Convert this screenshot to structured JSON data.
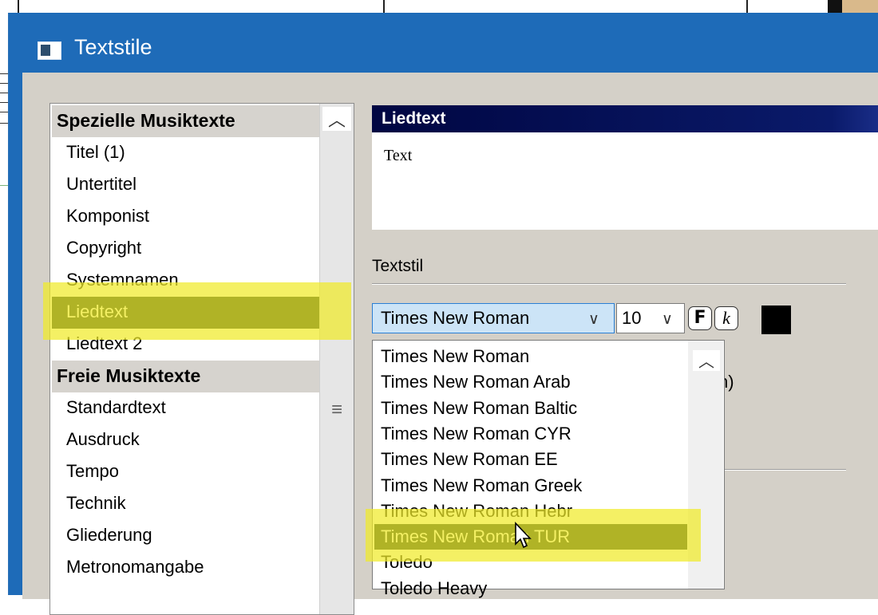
{
  "window": {
    "title": "Textstile"
  },
  "list": {
    "items": [
      {
        "label": "Spezielle Musiktexte",
        "kind": "header"
      },
      {
        "label": "Titel (1)",
        "kind": "item"
      },
      {
        "label": "Untertitel",
        "kind": "item"
      },
      {
        "label": "Komponist",
        "kind": "item"
      },
      {
        "label": "Copyright",
        "kind": "item"
      },
      {
        "label": "Systemnamen",
        "kind": "item"
      },
      {
        "label": "Liedtext",
        "kind": "item",
        "selected": true
      },
      {
        "label": "Liedtext 2",
        "kind": "item"
      },
      {
        "label": "Freie Musiktexte",
        "kind": "header"
      },
      {
        "label": "Standardtext",
        "kind": "item"
      },
      {
        "label": "Ausdruck",
        "kind": "item"
      },
      {
        "label": "Tempo",
        "kind": "item"
      },
      {
        "label": "Technik",
        "kind": "item"
      },
      {
        "label": "Gliederung",
        "kind": "item"
      },
      {
        "label": "Metronomangabe",
        "kind": "item"
      }
    ]
  },
  "preview": {
    "header": "Liedtext",
    "sample_text": "Text"
  },
  "textstil": {
    "label": "Textstil",
    "font": "Times New Roman",
    "size": "10",
    "bold_label": "F",
    "italic_label": "k",
    "color": "#000000",
    "partial_text": "n)"
  },
  "font_dropdown": {
    "options": [
      "Times New Roman",
      "Times New Roman Arab",
      "Times New Roman Baltic",
      "Times New Roman CYR",
      "Times New Roman EE",
      "Times New Roman Greek",
      "Times New Roman Hebr",
      "Times New Roman TUR",
      "Toledo",
      "Toledo Heavy"
    ],
    "selected": "Times New Roman TUR"
  },
  "colors": {
    "title_bar": "#1e6bb8",
    "dialog_bg": "#d4d0c8",
    "selection": "#0e2620",
    "highlight": "#f0ea28",
    "combo_focus": "#cce4f7"
  }
}
